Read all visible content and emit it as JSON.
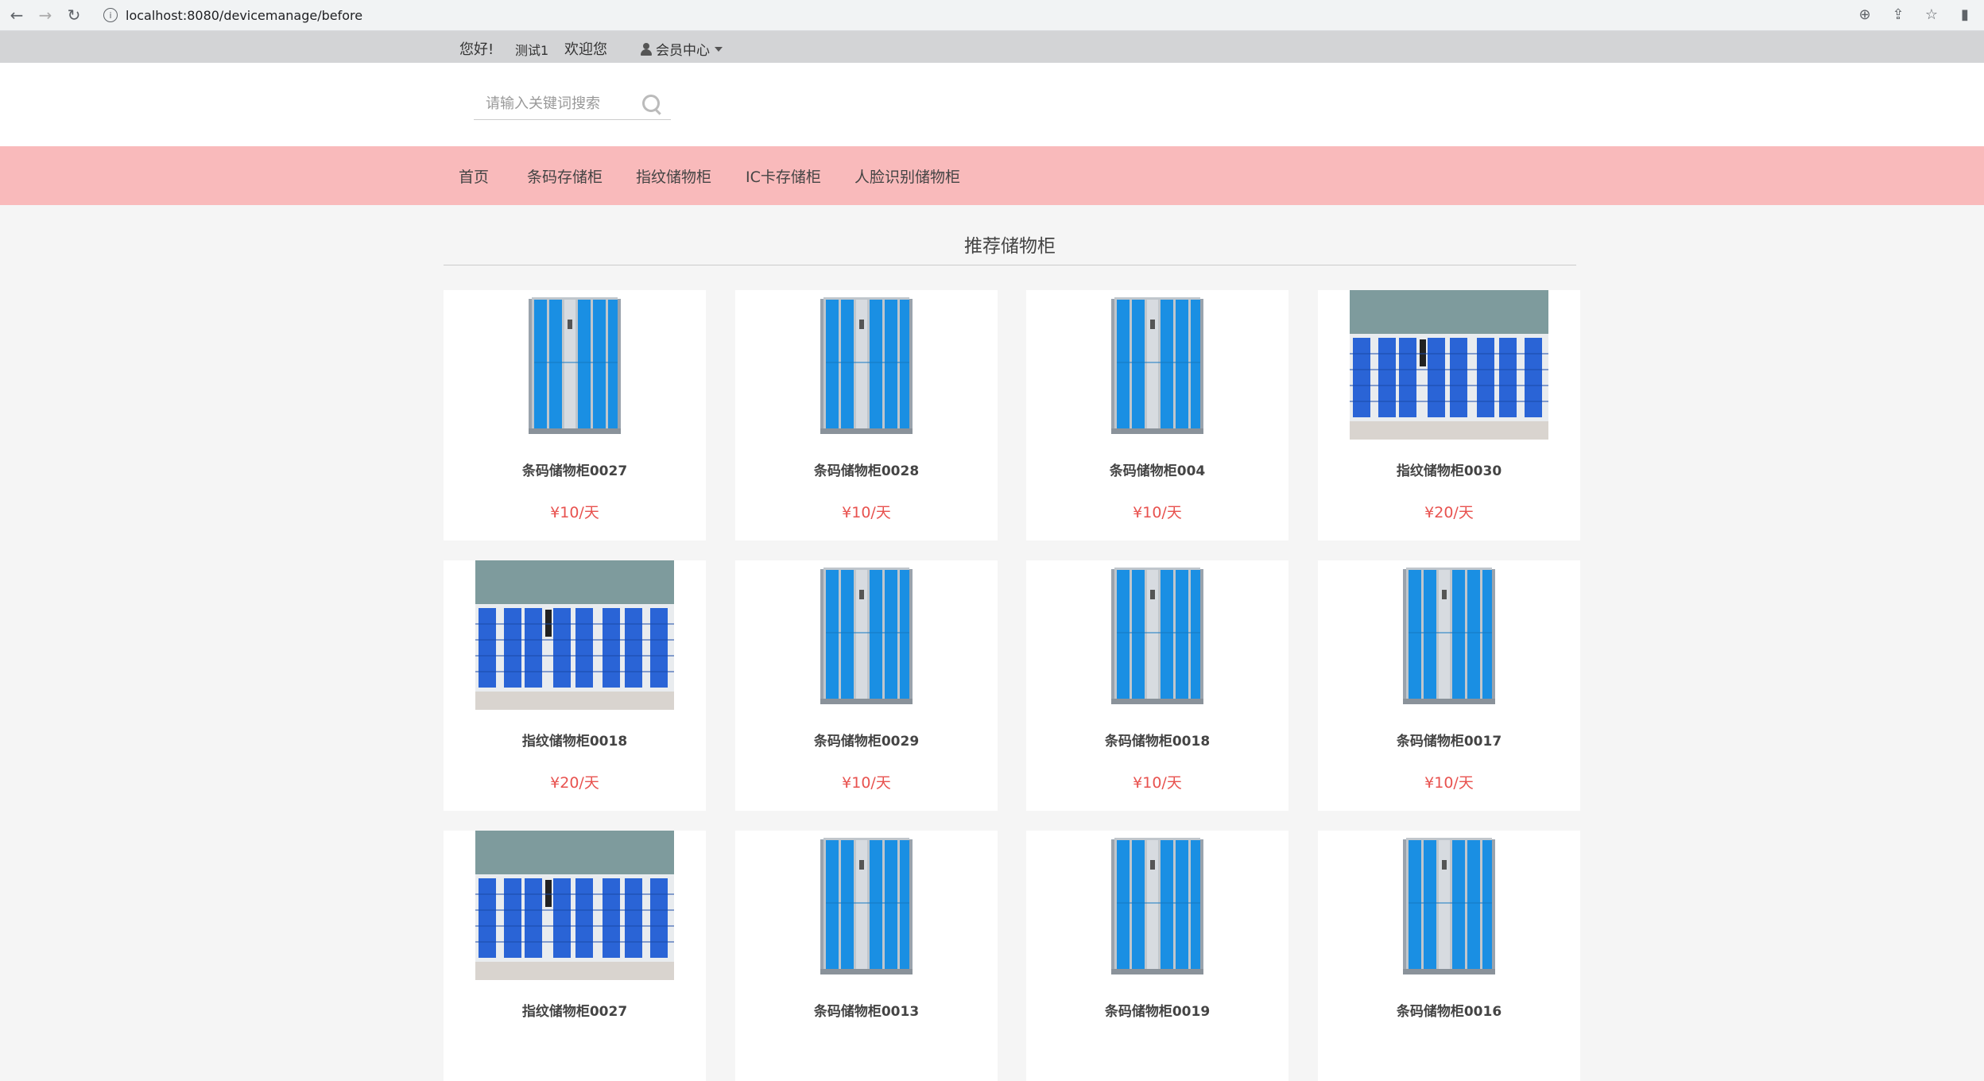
{
  "browser": {
    "url": "localhost:8080/devicemanage/before"
  },
  "topbar": {
    "greeting": "您好!",
    "username": "测试1",
    "welcome": "欢迎您",
    "member_center": "会员中心"
  },
  "search": {
    "placeholder": "请输入关键词搜索"
  },
  "nav": {
    "items": [
      "首页",
      "条码存储柜",
      "指纹储物柜",
      "IC卡存储柜",
      "人脸识别储物柜"
    ]
  },
  "section": {
    "title": "推荐储物柜"
  },
  "products": [
    {
      "name": "条码储物柜0027",
      "price": "¥10/天",
      "image": "tall-blue-cabinet"
    },
    {
      "name": "条码储物柜0028",
      "price": "¥10/天",
      "image": "tall-blue-cabinet"
    },
    {
      "name": "条码储物柜004",
      "price": "¥10/天",
      "image": "tall-blue-cabinet"
    },
    {
      "name": "指纹储物柜0030",
      "price": "¥20/天",
      "image": "wide-locker-wall"
    },
    {
      "name": "指纹储物柜0018",
      "price": "¥20/天",
      "image": "wide-locker-wall"
    },
    {
      "name": "条码储物柜0029",
      "price": "¥10/天",
      "image": "tall-blue-cabinet"
    },
    {
      "name": "条码储物柜0018",
      "price": "¥10/天",
      "image": "tall-blue-cabinet"
    },
    {
      "name": "条码储物柜0017",
      "price": "¥10/天",
      "image": "tall-blue-cabinet"
    },
    {
      "name": "指纹储物柜0027",
      "price": "",
      "image": "wide-locker-wall"
    },
    {
      "name": "条码储物柜0013",
      "price": "",
      "image": "tall-blue-cabinet"
    },
    {
      "name": "条码储物柜0019",
      "price": "",
      "image": "tall-blue-cabinet"
    },
    {
      "name": "条码储物柜0016",
      "price": "",
      "image": "tall-blue-cabinet"
    }
  ],
  "colors": {
    "nav_bg": "#f9babb",
    "topbar_bg": "#d3d4d6",
    "price": "#e8524f",
    "cabinet_blue": "#1a8fe3"
  }
}
